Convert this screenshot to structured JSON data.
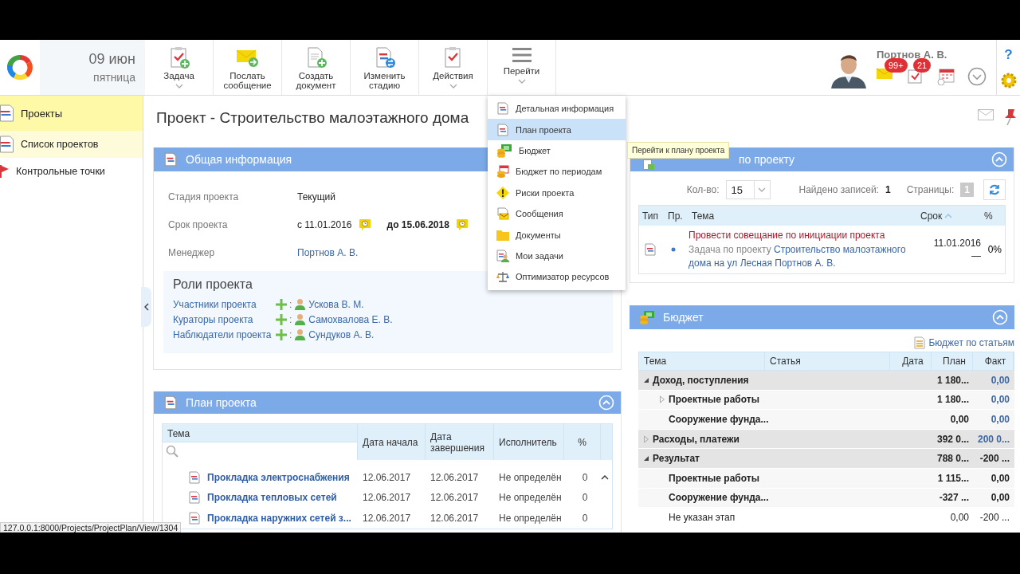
{
  "header": {
    "date": "09 июн",
    "weekday": "пятница",
    "user": "Портнов А. В.",
    "mail_badge": "99+",
    "task_badge": "21",
    "help": "?"
  },
  "toolbar": [
    {
      "label": "Задача",
      "dropdown": true
    },
    {
      "label": "Послать сообщение",
      "dropdown": false
    },
    {
      "label": "Создать документ",
      "dropdown": false
    },
    {
      "label": "Изменить стадию",
      "dropdown": false
    },
    {
      "label": "Действия",
      "dropdown": true
    },
    {
      "label": "Перейти",
      "dropdown": true
    }
  ],
  "sidebar": {
    "section": "Проекты",
    "items": [
      {
        "label": "Список проектов",
        "selected": true
      },
      {
        "label": "Контрольные точки",
        "selected": false
      }
    ]
  },
  "page_title": "Проект - Строительство малоэтажного дома",
  "info": {
    "title": "Общая информация",
    "fields": [
      {
        "label": "Стадия проекта",
        "kind": "text",
        "value": "Текущий"
      },
      {
        "label": "Срок проекта",
        "kind": "period",
        "from": "с 11.01.2016",
        "to": "до 15.06.2018"
      },
      {
        "label": "Менеджер",
        "kind": "link",
        "value": "Портнов А. В."
      }
    ],
    "roles_title": "Роли проекта",
    "roles": [
      {
        "role": "Участники проекта",
        "separator": ":",
        "person": "Ускова В. М."
      },
      {
        "role": "Кураторы проекта",
        "separator": ":",
        "person": "Самохвалова Е. В."
      },
      {
        "role": "Наблюдатели проекта",
        "separator": ":",
        "person": "Сундуков А. В."
      }
    ]
  },
  "plan": {
    "title": "План проекта",
    "columns": [
      "Тема",
      "Дата начала",
      "Дата завершения",
      "Исполнитель",
      "%"
    ],
    "rows": [
      {
        "title": "Прокладка электроснабжения",
        "start": "12.06.2017",
        "end": "12.06.2017",
        "assignee": "Не определён",
        "percent": "0"
      },
      {
        "title": "Прокладка тепловых сетей",
        "start": "12.06.2017",
        "end": "12.06.2017",
        "assignee": "Не определён",
        "percent": "0"
      },
      {
        "title": "Прокладка наружних сетей з...",
        "start": "12.06.2017",
        "end": "12.06.2017",
        "assignee": "Не определён",
        "percent": "0"
      }
    ]
  },
  "nav_menu": {
    "items": [
      {
        "label": "Детальная информация",
        "selected": false
      },
      {
        "label": "План проекта",
        "selected": true
      },
      {
        "label": "Бюджет",
        "selected": false
      },
      {
        "label": "Бюджет по периодам",
        "selected": false
      },
      {
        "label": "Риски проекта",
        "selected": false
      },
      {
        "label": "Сообщения",
        "selected": false
      },
      {
        "label": "Документы",
        "selected": false
      },
      {
        "label": "Мои задачи",
        "selected": false
      },
      {
        "label": "Оптимизатор ресурсов",
        "selected": false
      }
    ],
    "tooltip": "Перейти к плану проекта"
  },
  "tasks": {
    "title": "по проекту",
    "count_label": "Кол-во:",
    "count": "15",
    "found_label": "Найдено записей:",
    "found": "1",
    "pages_label": "Страницы:",
    "page": "1",
    "columns": [
      "Тип",
      "Пр.",
      "Тема",
      "Срок",
      "%"
    ],
    "rows": [
      {
        "title": "Провести совещание по инициации проекта",
        "prefix": "Задача по проекту",
        "project": "Строительство малоэтажного дома на ул Лесная Портнов А. В.",
        "due": "11.01.2016",
        "due_note": "—",
        "percent": "0%"
      }
    ]
  },
  "budget": {
    "title": "Бюджет",
    "link": "Бюджет по статьям",
    "columns": [
      "Тема",
      "Статья",
      "Дата",
      "План",
      "Факт"
    ],
    "rows": [
      {
        "theme": "Доход, поступления",
        "kind": "group",
        "expanded": true,
        "plan": "1 180...",
        "fact": "0,00",
        "fact_linked": true,
        "children": [
          {
            "theme": "Проектные работы",
            "kind": "stage",
            "expanded": false,
            "plan": "1 180...",
            "fact": "0,00",
            "fact_linked": true
          },
          {
            "theme": "Сооружение фунда...",
            "kind": "stage",
            "plan": "0,00",
            "fact": "0,00",
            "fact_linked": true
          }
        ]
      },
      {
        "theme": "Расходы, платежи",
        "kind": "group",
        "expanded": false,
        "plan": "392 0...",
        "fact": "200 0...",
        "fact_linked": true
      },
      {
        "theme": "Результат",
        "kind": "group",
        "expanded": true,
        "plan": "788 0...",
        "fact": "-200 ...",
        "fact_linked": false,
        "children": [
          {
            "theme": "Проектные работы",
            "kind": "stage",
            "plan": "1 115...",
            "fact": "0,00",
            "fact_linked": false
          },
          {
            "theme": "Сооружение фунда...",
            "kind": "stage",
            "plan": "-327 ...",
            "fact": "0,00",
            "fact_linked": false
          },
          {
            "theme": "Не указан этап",
            "kind": "unassigned",
            "plan": "0,00",
            "fact": "-200 ...",
            "fact_linked": false
          }
        ]
      }
    ]
  },
  "status_url": "127.0.0.1:8000/Projects/ProjectPlan/View/1304"
}
